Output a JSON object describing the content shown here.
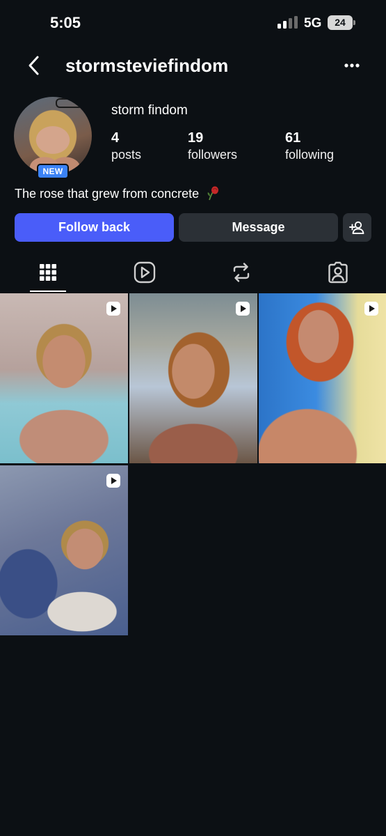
{
  "status_bar": {
    "time": "5:05",
    "network": "5G",
    "battery": "24"
  },
  "header": {
    "back_icon": "chevron-left-icon",
    "username": "stormsteviefindom",
    "more_icon": "more-horizontal-icon"
  },
  "profile": {
    "new_badge": "NEW",
    "display_name": "storm findom",
    "stats": {
      "posts": {
        "value": "4",
        "label": "posts"
      },
      "followers": {
        "value": "19",
        "label": "followers"
      },
      "following": {
        "value": "61",
        "label": "following"
      }
    },
    "bio": "The rose that grew from concrete",
    "bio_emoji": "wilted-rose-icon"
  },
  "actions": {
    "follow_label": "Follow back",
    "message_label": "Message",
    "add_user_icon": "add-user-icon"
  },
  "tabs": [
    "grid-icon",
    "reels-icon",
    "reposts-icon",
    "tagged-icon"
  ],
  "colors": {
    "background": "#0c1014",
    "accent": "#4a5df9",
    "secondary_button": "#2b3036",
    "badge": "#3b82f6"
  },
  "posts": [
    {
      "type": "reel"
    },
    {
      "type": "reel"
    },
    {
      "type": "reel"
    },
    {
      "type": "reel"
    }
  ]
}
